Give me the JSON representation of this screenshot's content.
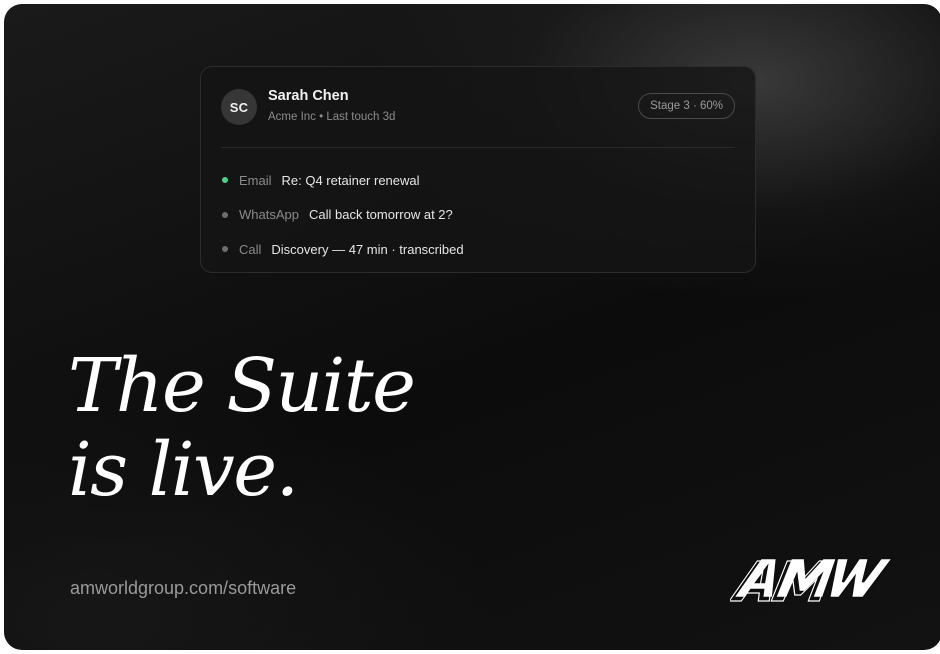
{
  "contact": {
    "initials": "SC",
    "name": "Sarah Chen",
    "meta": "Acme Inc • Last touch 3d",
    "stage": "Stage 3 · 60%"
  },
  "activities": [
    {
      "channel": "Email",
      "subject": "Re: Q4 retainer renewal",
      "active": true
    },
    {
      "channel": "WhatsApp",
      "subject": "Call back tomorrow at 2?",
      "active": false
    },
    {
      "channel": "Call",
      "subject": "Discovery — 47 min · transcribed",
      "active": false
    }
  ],
  "headline": {
    "line1": "The Suite",
    "line2": "is live."
  },
  "footer": {
    "url": "amworldgroup.com/software"
  },
  "brand": {
    "logo_text": "AMW"
  },
  "colors": {
    "background": "#0e0e0e",
    "card": "#141414",
    "active_dot": "#4cd38a",
    "inactive_dot": "#6f6f6f",
    "text_primary": "#ffffff",
    "text_muted": "#8a8a8a"
  }
}
